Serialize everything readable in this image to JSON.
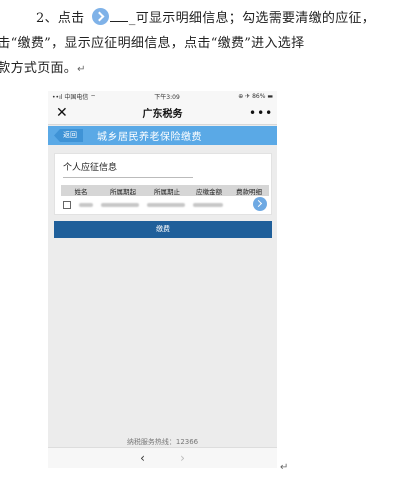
{
  "document": {
    "line1_before": "2、点击 ",
    "line1_after": "_可显示明细信息；勾选需要清缴的应征，",
    "line2": "点击“缴费”，显示应征明细信息，点击“缴费”进入选择",
    "line3": "缴款方式页面。",
    "return_mark": "↵",
    "end_mark": "↵"
  },
  "phone": {
    "status": {
      "carrier": "••ıl 中国电信 ⌔",
      "time": "下午3:09",
      "battery": "⊕ ✈ 86% ▬"
    },
    "nav": {
      "close": "✕",
      "title": "广东税务",
      "more": "•••"
    },
    "banner": {
      "back": "返回",
      "title": "城乡居民养老保险缴费"
    },
    "card": {
      "title": "个人应征信息",
      "columns": [
        "姓名",
        "所属期起",
        "所属期止",
        "应缴金额",
        "费款明细"
      ]
    },
    "pay_button": "缴费",
    "hotline": "纳税服务热线：12366",
    "bottom": {
      "back": "‹",
      "forward": "›"
    }
  }
}
